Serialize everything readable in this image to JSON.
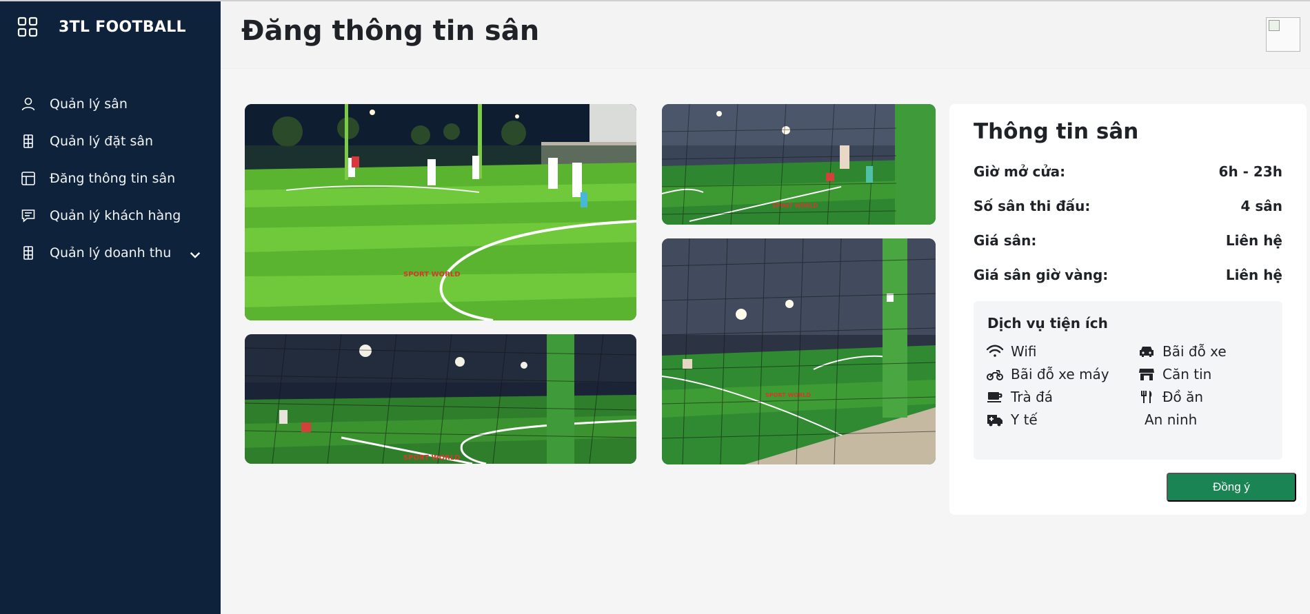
{
  "brand": {
    "name": "3TL FOOTBALL",
    "icon": "grid-icon"
  },
  "sidebar": {
    "items": [
      {
        "label": "Quản lý sân",
        "icon": "user-icon"
      },
      {
        "label": "Quản lý đặt sân",
        "icon": "building-icon"
      },
      {
        "label": "Đăng thông tin sân",
        "icon": "layout-icon"
      },
      {
        "label": "Quản lý khách hàng",
        "icon": "message-icon"
      },
      {
        "label": "Quản lý doanh thu",
        "icon": "building-icon",
        "has_submenu": true
      }
    ]
  },
  "header": {
    "title": "Đăng thông tin sân",
    "avatar_icon": "broken-image-icon"
  },
  "photos": [
    {
      "name": "field-photo-1",
      "watermark": "SPORT WORLD"
    },
    {
      "name": "field-photo-2",
      "watermark": "SPORT WORLD"
    },
    {
      "name": "field-photo-3",
      "watermark": "SPORT WORLD"
    },
    {
      "name": "field-photo-4",
      "watermark": "SPORT WORLD"
    }
  ],
  "info": {
    "title": "Thông tin sân",
    "rows": [
      {
        "label": "Giờ mở cửa:",
        "value": "6h - 23h"
      },
      {
        "label": "Số sân thi đấu:",
        "value": "4 sân"
      },
      {
        "label": "Giá sân:",
        "value": "Liên hệ"
      },
      {
        "label": "Giá sân giờ vàng:",
        "value": "Liên hệ"
      }
    ],
    "services_title": "Dịch vụ tiện ích",
    "services": [
      {
        "label": "Wifi",
        "icon": "wifi-icon"
      },
      {
        "label": "Bãi đỗ xe",
        "icon": "car-icon"
      },
      {
        "label": "Bãi đỗ xe máy",
        "icon": "motorcycle-icon"
      },
      {
        "label": "Căn tin",
        "icon": "store-icon"
      },
      {
        "label": "Trà đá",
        "icon": "mug-icon"
      },
      {
        "label": "Đồ ăn",
        "icon": "utensils-icon"
      },
      {
        "label": "Y tế",
        "icon": "ambulance-icon"
      },
      {
        "label": "An ninh",
        "icon": ""
      }
    ],
    "agree_label": "Đồng ý"
  },
  "colors": {
    "sidebar_bg": "#0e223b",
    "page_bg": "#f5f5f5",
    "agree_button": "#1a8454",
    "grass": "#5fb832"
  }
}
